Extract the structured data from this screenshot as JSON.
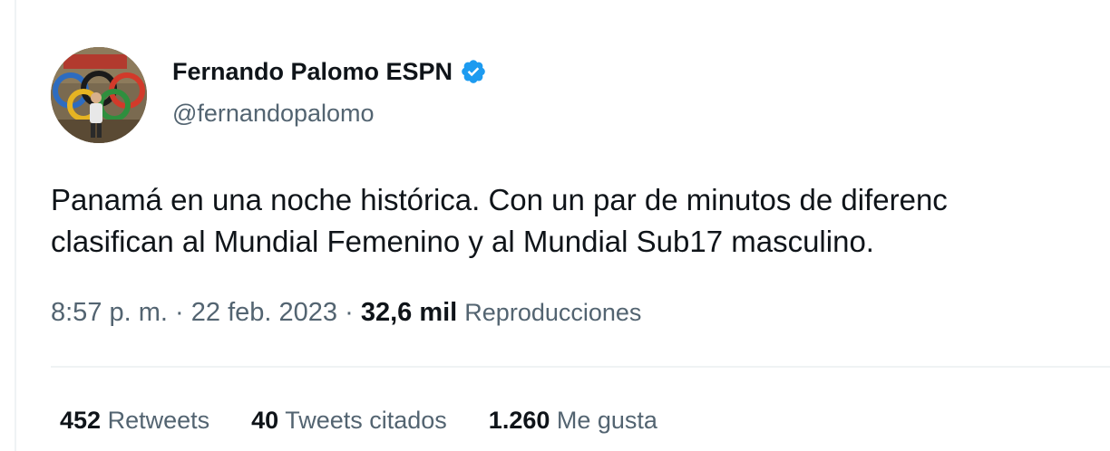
{
  "author": {
    "display_name": "Fernando Palomo ESPN",
    "handle": "@fernandopalomo",
    "verified_icon": "verified-badge-icon",
    "verified_color": "#1d9bf0"
  },
  "tweet": {
    "text_line1": "Panamá en una noche histórica. Con un par de minutos de diferenc",
    "text_line2": "clasifican al Mundial Femenino y al Mundial Sub17 masculino."
  },
  "meta": {
    "time": "8:57 p. m.",
    "separator": "·",
    "date": "22 feb. 2023",
    "views_count": "32,6 mil",
    "views_label": "Reproducciones"
  },
  "stats": [
    {
      "count": "452",
      "label": "Retweets"
    },
    {
      "count": "40",
      "label": "Tweets citados"
    },
    {
      "count": "1.260",
      "label": "Me gusta"
    }
  ],
  "colors": {
    "text_primary": "#0f1419",
    "text_secondary": "#536471",
    "border": "#eff3f4"
  }
}
